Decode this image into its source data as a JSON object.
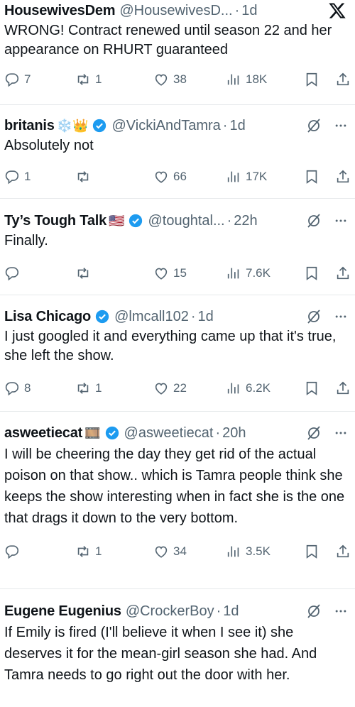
{
  "replies": [
    {
      "name": "HousewivesDem",
      "emoji": "",
      "verified": false,
      "handle": "@HousewivesD...",
      "time": "1d",
      "text": "WRONG! Contract renewed until season 22 and her appearance on RHURT guaranteed",
      "replies": "7",
      "reposts": "1",
      "likes": "38",
      "views": "18K"
    },
    {
      "name": "britanis",
      "emoji": "❄️👑",
      "verified": true,
      "handle": "@VickiAndTamra",
      "time": "1d",
      "text": "Absolutely not",
      "replies": "1",
      "reposts": "",
      "likes": "66",
      "views": "17K"
    },
    {
      "name": "Ty’s Tough Talk",
      "emoji": "🇺🇸",
      "verified": true,
      "handle": "@toughtal...",
      "time": "22h",
      "text": "Finally.",
      "replies": "",
      "reposts": "",
      "likes": "15",
      "views": "7.6K"
    },
    {
      "name": "Lisa Chicago",
      "emoji": "",
      "verified": true,
      "handle": "@lmcall102",
      "time": "1d",
      "text": "I just googled it and everything came up that it's true,  she left the show.",
      "replies": "8",
      "reposts": "1",
      "likes": "22",
      "views": "6.2K"
    },
    {
      "name": "asweetiecat",
      "emoji": "🎞️",
      "verified": true,
      "handle": "@asweetiecat",
      "time": "20h",
      "text": "I will be cheering the day they get rid of the actual poison on that show.. which is Tamra people think she keeps the show interesting when in fact she is the one that drags it down to the very bottom.",
      "replies": "",
      "reposts": "1",
      "likes": "34",
      "views": "3.5K"
    },
    {
      "name": "Eugene Eugenius",
      "emoji": "",
      "verified": false,
      "handle": "@CrockerBoy",
      "time": "1d",
      "text": "If Emily is fired (I'll believe it when I see it) she deserves it for the mean-girl season she had. And Tamra needs to go right out the door with her.",
      "replies": "",
      "reposts": "",
      "likes": "",
      "views": ""
    }
  ],
  "separator": "·",
  "colors": {
    "text": "#0f1419",
    "muted": "#536471",
    "verified": "#1d9bf0",
    "divider": "#e6e9eb"
  },
  "icons": [
    "x-logo-icon",
    "verified-badge-icon",
    "grok-icon",
    "more-icon",
    "reply-icon",
    "repost-icon",
    "like-icon",
    "views-icon",
    "bookmark-icon",
    "share-icon"
  ]
}
